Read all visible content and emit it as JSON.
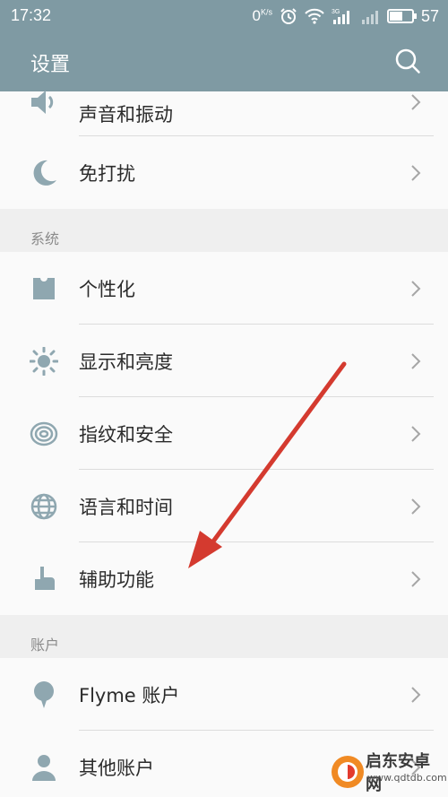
{
  "status_bar": {
    "time": "17:32",
    "net_speed": "0",
    "net_speed_unit": "K/s",
    "signal_label": "3G",
    "battery": "57",
    "battery_level": 0.57
  },
  "app_bar": {
    "title": "设置",
    "search_icon": "search-icon"
  },
  "sections": {
    "top_rows": [
      {
        "label": "声音和振动",
        "icon": "speaker-icon"
      },
      {
        "label": "免打扰",
        "icon": "moon-icon"
      }
    ],
    "system": {
      "header": "系统",
      "rows": [
        {
          "label": "个性化",
          "icon": "shirt-icon"
        },
        {
          "label": "显示和亮度",
          "icon": "sun-icon"
        },
        {
          "label": "指纹和安全",
          "icon": "fingerprint-icon"
        },
        {
          "label": "语言和时间",
          "icon": "globe-icon"
        },
        {
          "label": "辅助功能",
          "icon": "hand-icon"
        }
      ]
    },
    "account": {
      "header": "账户",
      "rows": [
        {
          "label": "Flyme 账户",
          "icon": "balloon-icon"
        },
        {
          "label": "其他账户",
          "icon": "person-icon"
        }
      ]
    }
  },
  "watermark": {
    "name": "启东安卓网",
    "url": "www.qdtdb.com"
  },
  "colors": {
    "app_bar": "#7f9aa3",
    "icon": "#8fa7b0",
    "arrow": "#d43a2f"
  }
}
